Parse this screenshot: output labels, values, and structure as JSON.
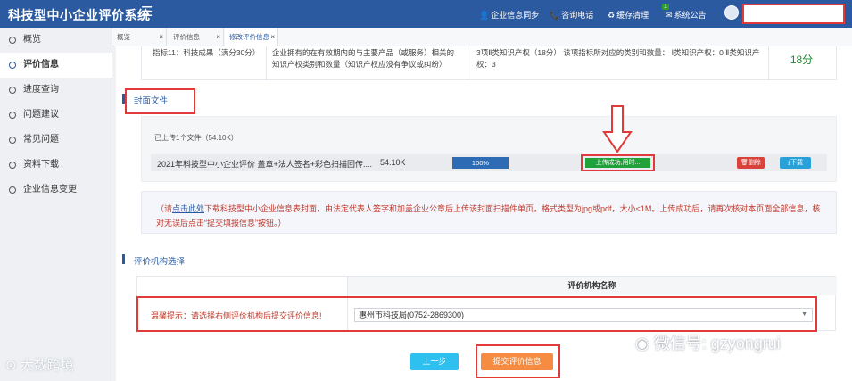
{
  "app": {
    "title": "科技型中小企业评价系统",
    "menu_icon": "hamburger-icon"
  },
  "topnav": {
    "sync_label": "企业信息同步",
    "phone_label": "咨询电话",
    "cache_label": "缓存清理",
    "notice_label": "系统公告",
    "notice_count": "1"
  },
  "sidebar": {
    "items": [
      {
        "label": "概览"
      },
      {
        "label": "评价信息"
      },
      {
        "label": "进度查询"
      },
      {
        "label": "问题建议"
      },
      {
        "label": "常见问题"
      },
      {
        "label": "资料下载"
      },
      {
        "label": "企业信息变更"
      }
    ]
  },
  "tabs": [
    {
      "label": "概览"
    },
    {
      "label": "评价信息"
    },
    {
      "label": "修改评价信息"
    }
  ],
  "score_row": {
    "indicator": "指标11：科技成果（满分30分）",
    "description": "企业拥有的在有效期内的与主要产品（或服务）相关的知识产权类别和数量（知识产权应没有争议或纠纷）",
    "detail": "3项Ⅱ类知识产权（18分） 该项指标所对应的类别和数量： Ⅰ类知识产权：0 Ⅱ类知识产权：3",
    "score": "18分"
  },
  "cover": {
    "section_title": "封面文件",
    "uploaded_count": "已上传1个文件（54.10K）",
    "file_name": "2021年科技型中小企业评价 盖章+法人签名+彩色扫描回传....",
    "file_size": "54.10K",
    "progress": "100%",
    "status": "上传成功,用时...",
    "delete_label": "删除",
    "download_label": "下载"
  },
  "note": {
    "prefix": "（请",
    "link": "点击此处",
    "text": "下载科技型中小企业信息表封面，由法定代表人签字和加盖企业公章后上传该封面扫描件单页，格式类型为jpg或pdf，大小<1M。上传成功后，请再次核对本页面全部信息，核对无误后点击“提交填报信息”按钮。）"
  },
  "institution": {
    "section_title": "评价机构选择",
    "column_header": "评价机构名称",
    "tip": "温馨提示：请选择右侧评价机构后提交评价信息!",
    "selected": "惠州市科技局(0752-2869300)"
  },
  "actions": {
    "prev_label": "上一步",
    "submit_label": "提交评价信息"
  },
  "watermarks": {
    "left": "大数跨境",
    "right": "微信号: gzyongrui"
  },
  "colors": {
    "primary": "#2c5aa0",
    "highlight_red": "#e03a3a",
    "success_green": "#20a13a",
    "submit_orange": "#f58c42",
    "prev_cyan": "#2ec0ee"
  }
}
